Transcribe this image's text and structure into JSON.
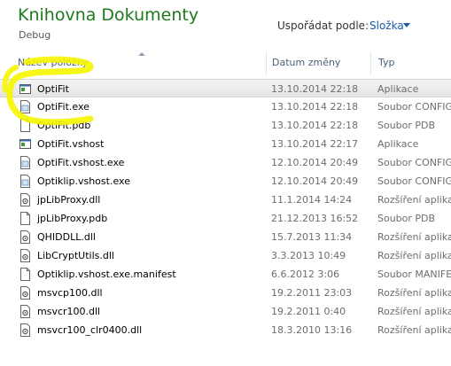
{
  "library": {
    "title": "Knihovna Dokumenty",
    "subtitle": "Debug"
  },
  "sort": {
    "label": "Uspořádat podle:",
    "value": "Složka"
  },
  "columns": {
    "name": "Název položky",
    "date": "Datum změny",
    "type": "Typ"
  },
  "colors": {
    "title": "#1e7a1e",
    "link": "#1d5aa8",
    "highlight": "#f5f500"
  },
  "files": [
    {
      "name": "OptiFit",
      "date": "13.10.2014 22:18",
      "type": "Aplikace",
      "icon": "application-icon",
      "selected": true
    },
    {
      "name": "OptiFit.exe",
      "date": "13.10.2014 22:18",
      "type": "Soubor CONFIG",
      "icon": "config-file-icon"
    },
    {
      "name": "OptiFit.pdb",
      "date": "13.10.2014 22:18",
      "type": "Soubor PDB",
      "icon": "document-icon"
    },
    {
      "name": "OptiFit.vshost",
      "date": "13.10.2014 22:17",
      "type": "Aplikace",
      "icon": "application-icon"
    },
    {
      "name": "OptiFit.vshost.exe",
      "date": "12.10.2014 20:49",
      "type": "Soubor CONFIG",
      "icon": "config-file-icon"
    },
    {
      "name": "Optiklip.vshost.exe",
      "date": "12.10.2014 20:49",
      "type": "Soubor CONFIG",
      "icon": "config-file-icon"
    },
    {
      "name": "jpLibProxy.dll",
      "date": "11.1.2014 14:24",
      "type": "Rozšíření aplikace",
      "icon": "dll-file-icon"
    },
    {
      "name": "jpLibProxy.pdb",
      "date": "21.12.2013 16:52",
      "type": "Soubor PDB",
      "icon": "document-icon"
    },
    {
      "name": "QHIDDLL.dll",
      "date": "15.7.2013 11:34",
      "type": "Rozšíření aplikace",
      "icon": "dll-file-icon"
    },
    {
      "name": "LibCryptUtils.dll",
      "date": "3.3.2013 10:49",
      "type": "Rozšíření aplikace",
      "icon": "dll-file-icon"
    },
    {
      "name": "Optiklip.vshost.exe.manifest",
      "date": "6.6.2012 3:06",
      "type": "Soubor MANIFEST",
      "icon": "document-icon"
    },
    {
      "name": "msvcp100.dll",
      "date": "19.2.2011 23:03",
      "type": "Rozšíření aplikace",
      "icon": "dll-file-icon"
    },
    {
      "name": "msvcr100.dll",
      "date": "19.2.2011 0:40",
      "type": "Rozšíření aplikace",
      "icon": "dll-file-icon"
    },
    {
      "name": "msvcr100_clr0400.dll",
      "date": "18.3.2010 13:16",
      "type": "Rozšíření aplikace",
      "icon": "dll-file-icon"
    }
  ]
}
